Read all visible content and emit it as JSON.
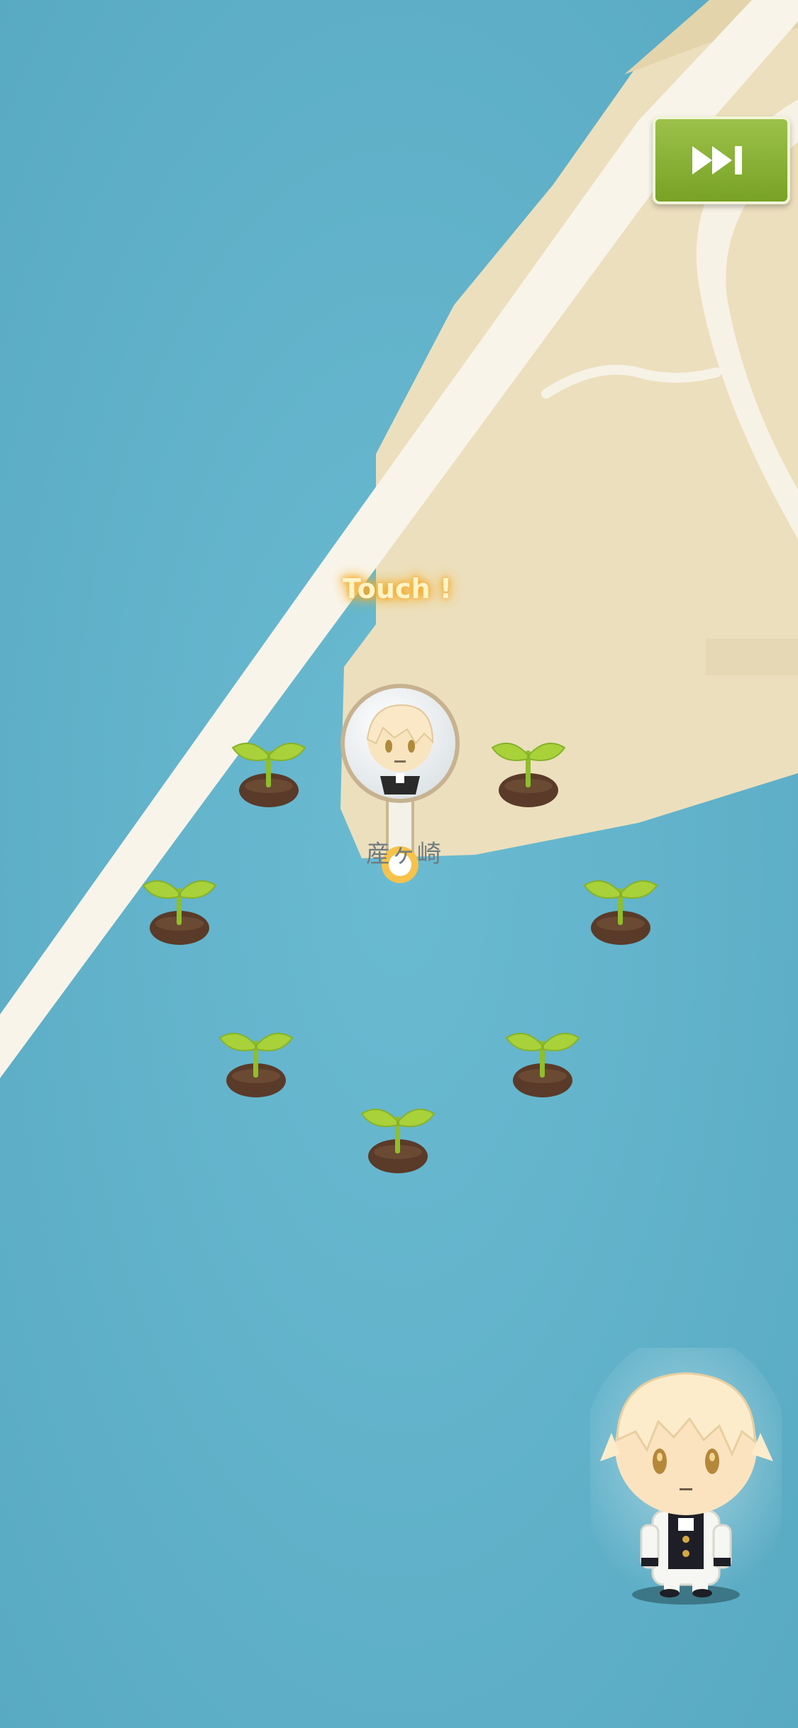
{
  "screen": {
    "touch_hint": "Touch !",
    "place_label": "産ヶ崎"
  },
  "controls": {
    "skip_icon": "fast-forward-icon",
    "accent": "#8db53a"
  },
  "colors": {
    "sea": "#62b4cc",
    "land": "#ecdfbd",
    "road": "#f8f4ea",
    "sprout_leaf": "#a8d13a",
    "sprout_soil": "#5a3a28",
    "hint_glow": "#f5a623"
  },
  "sprouts": [
    {
      "name": "sprout-1"
    },
    {
      "name": "sprout-2"
    },
    {
      "name": "sprout-3"
    },
    {
      "name": "sprout-4"
    },
    {
      "name": "sprout-5"
    },
    {
      "name": "sprout-6"
    },
    {
      "name": "sprout-7"
    }
  ]
}
